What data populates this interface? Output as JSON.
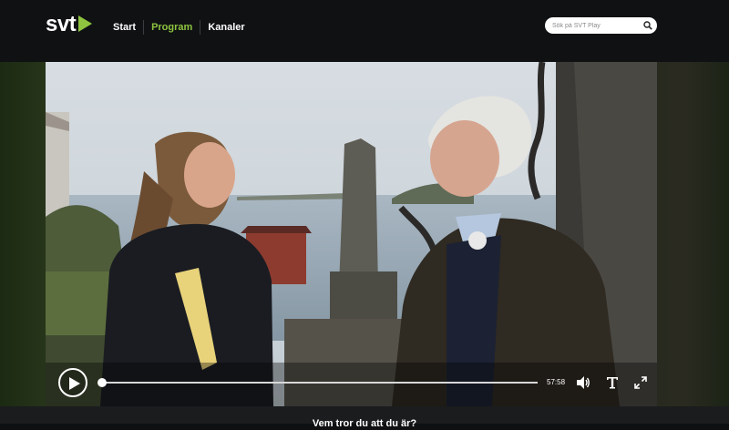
{
  "brand": {
    "logo_text": "svt",
    "logo_badge": "play",
    "accent": "#8ec43f"
  },
  "nav": {
    "items": [
      {
        "label": "Start",
        "active": false
      },
      {
        "label": "Program",
        "active": true
      },
      {
        "label": "Kanaler",
        "active": false
      }
    ]
  },
  "search": {
    "placeholder": "Sök på SVT Play",
    "value": "",
    "icon": "search-icon"
  },
  "player": {
    "state": "paused",
    "time_remaining": "57:58",
    "progress": 0.0,
    "icons": [
      "play-icon",
      "volume-icon",
      "subtitles-icon",
      "fullscreen-icon"
    ]
  },
  "below": {
    "heading": "Vem tror du att du är?"
  }
}
